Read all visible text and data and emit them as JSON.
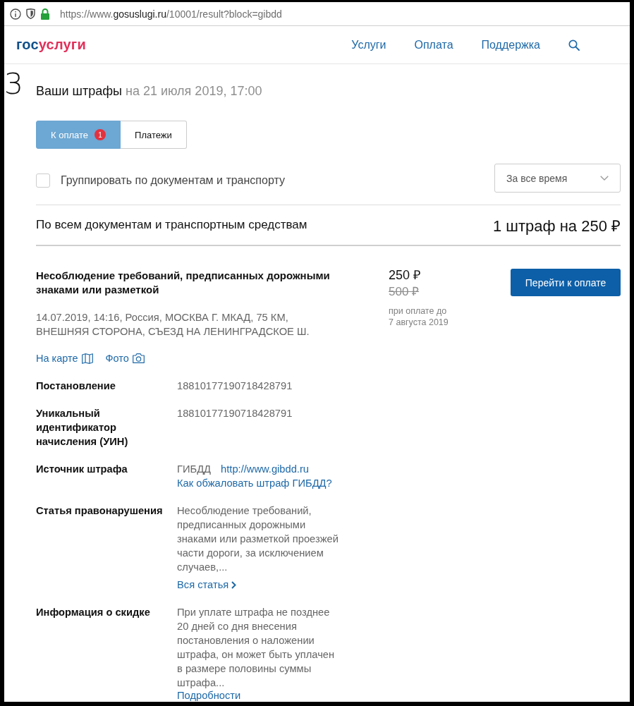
{
  "browser": {
    "url": [
      {
        "text": "https://www.",
        "kind": "muted"
      },
      {
        "text": "gosuslugi.ru",
        "kind": "host"
      },
      {
        "text": "/10001/result?block=gibdd",
        "kind": "muted"
      }
    ]
  },
  "header": {
    "logo": [
      {
        "text": "гос",
        "color": "#0f4f8a"
      },
      {
        "text": "услуги",
        "color": "#e1305a"
      }
    ],
    "nav": [
      {
        "label": "Услуги"
      },
      {
        "label": "Оплата"
      },
      {
        "label": "Поддержка"
      }
    ]
  },
  "edge_glyph": "З",
  "title": {
    "text": "Ваши штрафы",
    "date": "на 21 июля 2019, 17:00"
  },
  "tabs": [
    {
      "label": "К оплате",
      "selected": true,
      "badge": "1"
    },
    {
      "label": "Платежи",
      "selected": false
    }
  ],
  "group_filter": {
    "label": "Группировать по документам и транспорту",
    "checked": false
  },
  "period_select": {
    "value": "За все время"
  },
  "summary": {
    "label": "По всем документам и транспортным средствам",
    "total": "1 штраф на 250 ₽"
  },
  "fine": {
    "title": "Несоблюдение требований, предписанных дорожными знаками или разметкой",
    "description": "14.07.2019, 14:16, Россия, МОСКВА Г. МКАД, 75 КМ, ВНЕШНЯЯ СТОРОНА, СЪЕЗД НА ЛЕНИНГРАДСКОЕ Ш.",
    "amount": "250 ₽",
    "old_amount": "500 ₽",
    "deadline": "при оплате до 7 августа 2019",
    "pay_button": "Перейти к оплате",
    "links": [
      {
        "label": "На карте",
        "kind": "map"
      },
      {
        "label": "Фото",
        "kind": "photo"
      }
    ],
    "details": [
      {
        "label": "Постановление",
        "value": "18810177190718428791"
      },
      {
        "label": "Уникальный идентификатор начисления (УИН)",
        "value": "18810177190718428791"
      },
      {
        "label": "Источник штрафа",
        "value": "ГИБДД",
        "links": [
          {
            "text": "http://www.gibdd.ru",
            "kind": "inline"
          },
          {
            "text": "Как обжаловать штраф ГИБДД?",
            "kind": "block"
          }
        ]
      },
      {
        "label": "Статья правонарушения",
        "value": "Несоблюдение требований, предписанных дорожными знаками или разметкой проезжей части дороги, за исключением случаев,...",
        "links": [
          {
            "text": "Вся статья",
            "kind": "chevron"
          }
        ]
      },
      {
        "label": "Информация о скидке",
        "value": "При уплате штрафа не позднее 20 дней со дня внесения постановления о наложении штрафа, он может быть уплачен в размере половины суммы штрафа...",
        "links": [
          {
            "text": "Подробности",
            "kind": "dotted"
          }
        ]
      }
    ]
  }
}
